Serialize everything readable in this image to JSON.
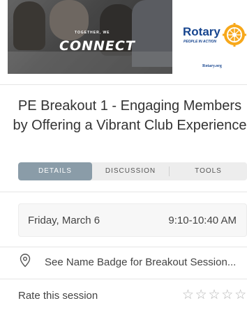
{
  "banner": {
    "tagline": "TOGETHER, WE",
    "headline": "CONNECT",
    "brand": "Rotary",
    "brand_sub": "PEOPLE IN ACTION",
    "brand_url": "Rotary.org",
    "brand_color": "#17458f",
    "wheel_color": "#f7a81b"
  },
  "session": {
    "title": "PE Breakout 1 - Engaging Members by Offering a Vibrant Club Experience"
  },
  "tabs": [
    {
      "label": "DETAILS",
      "active": true
    },
    {
      "label": "DISCUSSION",
      "active": false
    },
    {
      "label": "TOOLS",
      "active": false
    }
  ],
  "schedule": {
    "date": "Friday, March 6",
    "time": "9:10-10:40 AM"
  },
  "location": {
    "icon": "map-pin-icon",
    "text": "See Name Badge for Breakout Session..."
  },
  "rating": {
    "label": "Rate this session",
    "stars": [
      "☆",
      "☆",
      "☆",
      "☆",
      "☆"
    ],
    "value": 0,
    "max": 5
  },
  "colors": {
    "active_tab": "#8a9ca8",
    "tab_bar": "#ededed"
  }
}
